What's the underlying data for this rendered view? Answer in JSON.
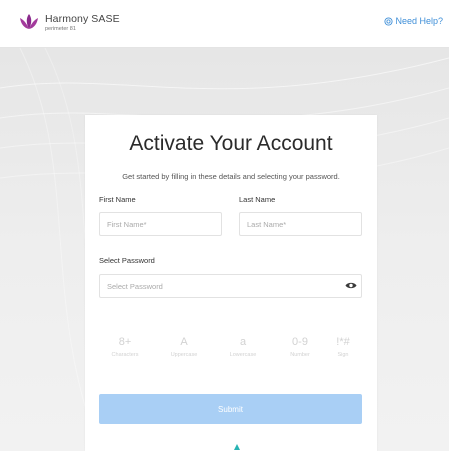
{
  "header": {
    "brand_name": "Harmony SASE",
    "brand_sub": "perimeter 81",
    "help_label": "Need Help?",
    "brand_color": "#8b2a8c",
    "help_color": "#3f8fd8",
    "icons": {
      "logo": "harmony-flower-logo",
      "help": "support-icon"
    }
  },
  "form": {
    "title": "Activate Your Account",
    "subtitle": "Get started by filling in these details and selecting your password.",
    "first_name": {
      "label": "First Name",
      "placeholder": "First Name*",
      "value": ""
    },
    "last_name": {
      "label": "Last Name",
      "placeholder": "Last Name*",
      "value": ""
    },
    "password": {
      "label": "Select Password",
      "placeholder": "Select Password",
      "value": "",
      "toggle_icon": "eye-icon"
    },
    "rules": [
      {
        "symbol": "8+",
        "label": "Characters"
      },
      {
        "symbol": "A",
        "label": "Uppercase"
      },
      {
        "symbol": "a",
        "label": "Lowercase"
      },
      {
        "symbol": "0-9",
        "label": "Number"
      },
      {
        "symbol": "!*#",
        "label": "Sign"
      }
    ],
    "submit_label": "Submit",
    "submit_color": "#a9cff5"
  }
}
